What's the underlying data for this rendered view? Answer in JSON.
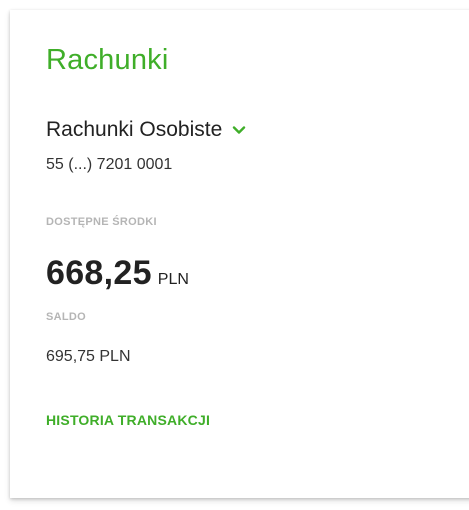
{
  "card": {
    "title": "Rachunki",
    "account_name": "Rachunki Osobiste",
    "account_number": "55 (...) 7201 0001",
    "available_label": "DOSTĘPNE ŚRODKI",
    "available_value": "668,25",
    "available_currency": "PLN",
    "balance_label": "SALDO",
    "balance_amount": "695,75 PLN",
    "history_link": "HISTORIA TRANSAKCJI",
    "dropdown_icon": "chevron-down-icon"
  },
  "colors": {
    "accent_green": "#3fae29",
    "label_gray": "#b5b5b5",
    "text_dark": "#222222"
  }
}
